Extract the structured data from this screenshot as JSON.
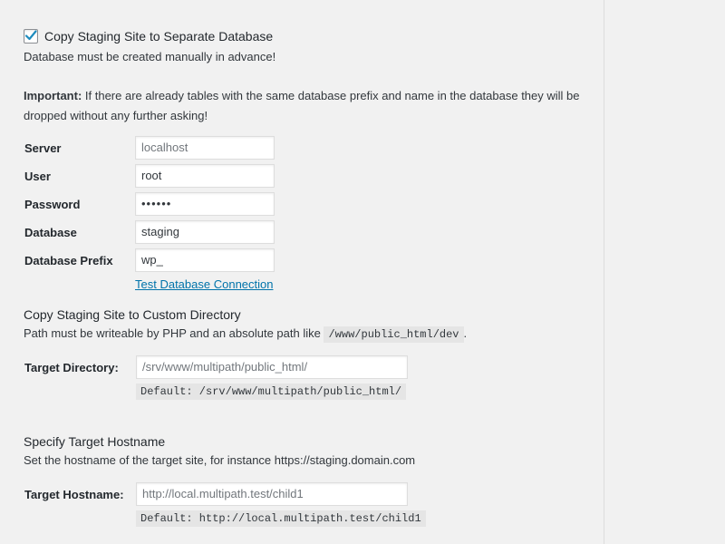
{
  "separate_db": {
    "checkbox_checked": true,
    "label": "Copy Staging Site to Separate Database",
    "note": "Database must be created manually in advance!",
    "important_prefix": "Important:",
    "important_text": " If there are already tables with the same database prefix and name in the database they will be dropped without any further asking!"
  },
  "db_fields": [
    {
      "label": "Server",
      "value": "",
      "placeholder": "localhost"
    },
    {
      "label": "User",
      "value": "root",
      "placeholder": ""
    },
    {
      "label": "Password",
      "value": "••••••",
      "placeholder": ""
    },
    {
      "label": "Database",
      "value": "staging",
      "placeholder": ""
    },
    {
      "label": "Database Prefix",
      "value": "wp_",
      "placeholder": ""
    }
  ],
  "test_connection_link": "Test Database Connection",
  "custom_directory": {
    "title": "Copy Staging Site to Custom Directory",
    "desc_before": "Path must be writeable by PHP and an absolute path like",
    "desc_code": "/www/public_html/dev",
    "desc_after": ".",
    "field_label": "Target Directory:",
    "placeholder": "/srv/www/multipath/public_html/",
    "default": "Default: /srv/www/multipath/public_html/"
  },
  "target_hostname": {
    "title": "Specify Target Hostname",
    "desc": "Set the hostname of the target site, for instance https://staging.domain.com",
    "field_label": "Target Hostname:",
    "placeholder": "http://local.multipath.test/child1",
    "default": "Default: http://local.multipath.test/child1"
  },
  "colors": {
    "background": "#f1f1f1",
    "link": "#0073aa",
    "checkmark": "#1e8cbe",
    "code_bg": "#e5e5e5"
  }
}
